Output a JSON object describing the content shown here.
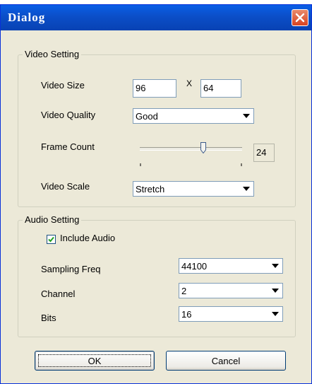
{
  "window": {
    "title": "Dialog"
  },
  "video": {
    "legend": "Video Setting",
    "size_label": "Video Size",
    "width": "96",
    "x_separator": "X",
    "height": "64",
    "quality_label": "Video Quality",
    "quality_value": "Good",
    "frame_label": "Frame Count",
    "frame_value": "24",
    "frame_slider_fraction": 0.62,
    "scale_label": "Video Scale",
    "scale_value": "Stretch"
  },
  "audio": {
    "legend": "Audio Setting",
    "include_label": "Include Audio",
    "include_checked": true,
    "freq_label": "Sampling Freq",
    "freq_value": "44100",
    "channel_label": "Channel",
    "channel_value": "2",
    "bits_label": "Bits",
    "bits_value": "16"
  },
  "buttons": {
    "ok": "OK",
    "cancel": "Cancel"
  }
}
